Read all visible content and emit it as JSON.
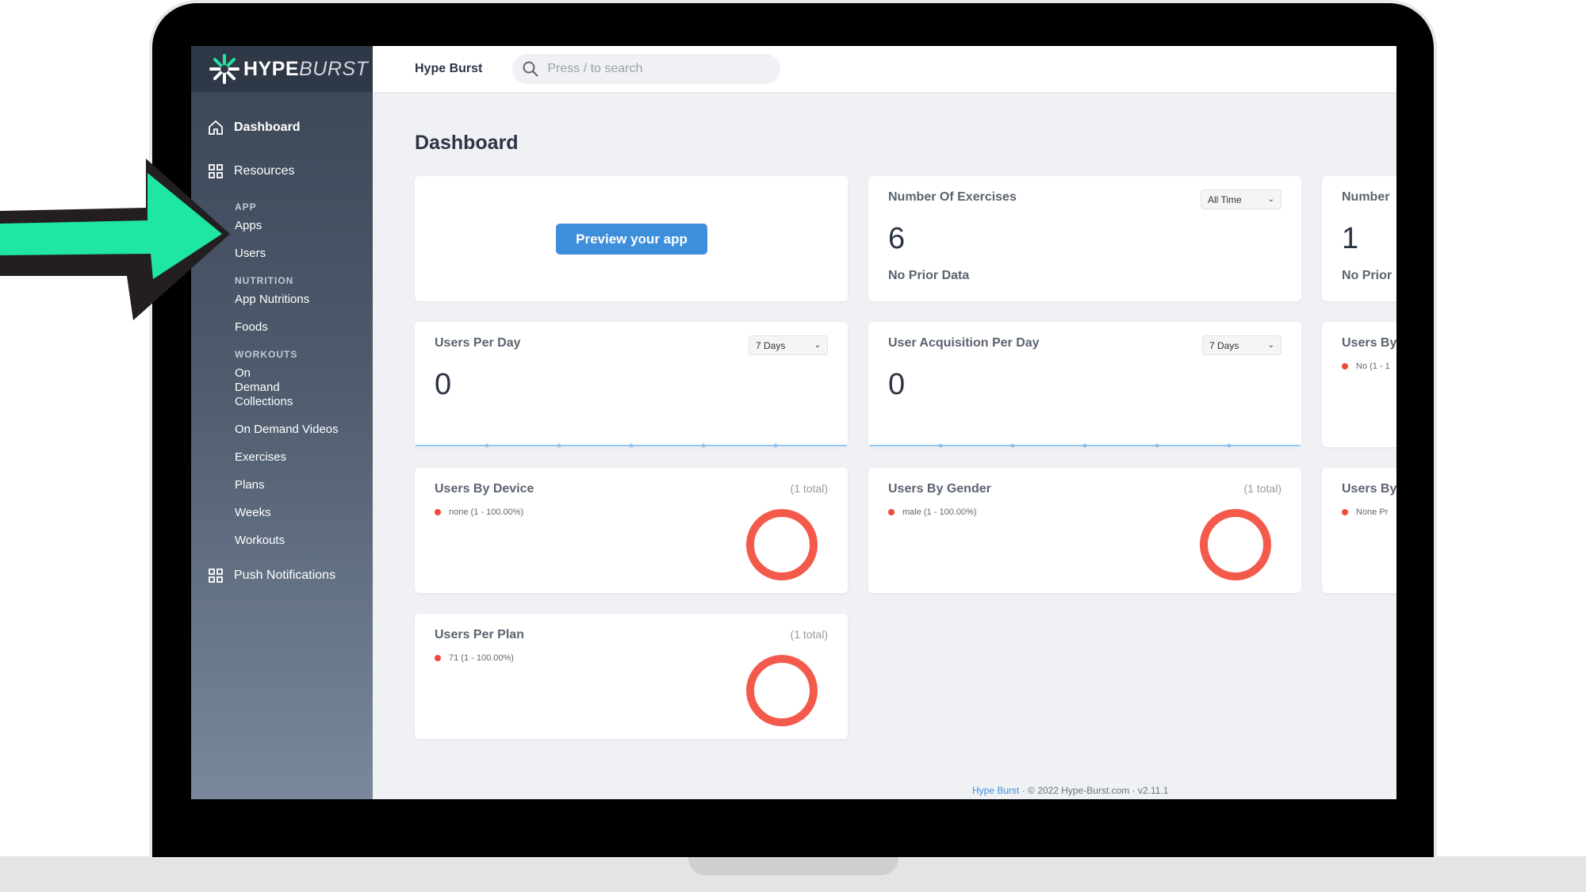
{
  "app": {
    "logo_hype": "HYPE",
    "logo_burst": "BURST",
    "brand": "Hype Burst",
    "search_placeholder": "Press / to search",
    "page_title": "Dashboard"
  },
  "sidebar": {
    "top": [
      {
        "label": "Dashboard",
        "icon": "home-icon"
      },
      {
        "label": "Resources",
        "icon": "grid-icon"
      }
    ],
    "sections": [
      {
        "title": "APP",
        "items": [
          "Apps",
          "Users"
        ]
      },
      {
        "title": "NUTRITION",
        "items": [
          "App Nutritions",
          "Foods"
        ]
      },
      {
        "title": "WORKOUTS",
        "items": [
          "On Demand Collections",
          "On Demand Videos",
          "Exercises",
          "Plans",
          "Weeks",
          "Workouts"
        ]
      }
    ],
    "bottom": {
      "label": "Push Notifications",
      "icon": "grid-icon"
    }
  },
  "cards": {
    "preview": {
      "button": "Preview your app"
    },
    "exercises": {
      "title": "Number Of Exercises",
      "filter": "All Time",
      "value": "6",
      "sub": "No Prior Data"
    },
    "third_top": {
      "title": "Number",
      "value": "1",
      "sub": "No Prior"
    },
    "users_per_day": {
      "title": "Users Per Day",
      "filter": "7 Days",
      "value": "0"
    },
    "acquisition": {
      "title": "User Acquisition Per Day",
      "filter": "7 Days",
      "value": "0"
    },
    "third_mid": {
      "title": "Users By",
      "legend": "No (1 - 1"
    },
    "device": {
      "title": "Users By Device",
      "total": "(1 total)",
      "legend": "none (1 - 100.00%)"
    },
    "gender": {
      "title": "Users By Gender",
      "total": "(1 total)",
      "legend": "male (1 - 100.00%)"
    },
    "third_bot": {
      "title": "Users By",
      "legend": "None Pr"
    },
    "plan": {
      "title": "Users Per Plan",
      "total": "(1 total)",
      "legend": "71 (1 - 100.00%)"
    }
  },
  "footer": {
    "link": "Hype Burst",
    "sep": "·",
    "copyright": "© 2022 Hype-Burst.com",
    "version": "v2.11.1"
  },
  "colors": {
    "accent": "#3d8fdc",
    "donut": "#f45a4b",
    "arrow": "#1fe6a0"
  }
}
